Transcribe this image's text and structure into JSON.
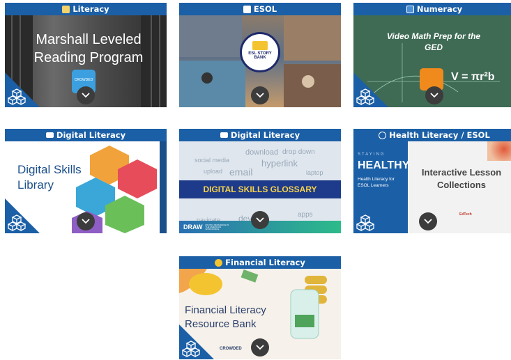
{
  "cards": [
    {
      "category": "Literacy",
      "image_title": "Marshall Leveled Reading Program",
      "logo_text": "CROWDED"
    },
    {
      "category": "ESOL",
      "image_title": "ESL STORY BANK"
    },
    {
      "category": "Numeracy",
      "image_title": "Video Math Prep for the GED",
      "formula": "V = πr²b"
    },
    {
      "category": "Digital Literacy",
      "image_title": "Digital Skills Library"
    },
    {
      "category": "Digital Literacy",
      "image_title": "DIGITAL SKILLS GLOSSARY",
      "cloud_words": [
        "download",
        "drop down",
        "social media",
        "hyperlink",
        "email",
        "upload",
        "device",
        "navigate",
        "laptop",
        "apps"
      ],
      "footer_logo": "DRAW",
      "footer_text": "DIGITAL RESILIENCE IN THE AMERICAN WORKFORCE"
    },
    {
      "category": "Health Literacy / ESOL",
      "staying": "STAYING",
      "healthy": "HEALTHY",
      "subtitle": "Health Literacy for ESOL Learners",
      "image_title": "Interactive Lesson Collections",
      "partner_logo": "EdTech"
    },
    {
      "category": "Financial Literacy",
      "image_title": "Financial Literacy Resource Bank",
      "logo_text": "CROWDED"
    }
  ],
  "colors": {
    "header": "#1b5fa6",
    "corner": "#1b5fa6",
    "button": "#3c3c3c"
  }
}
